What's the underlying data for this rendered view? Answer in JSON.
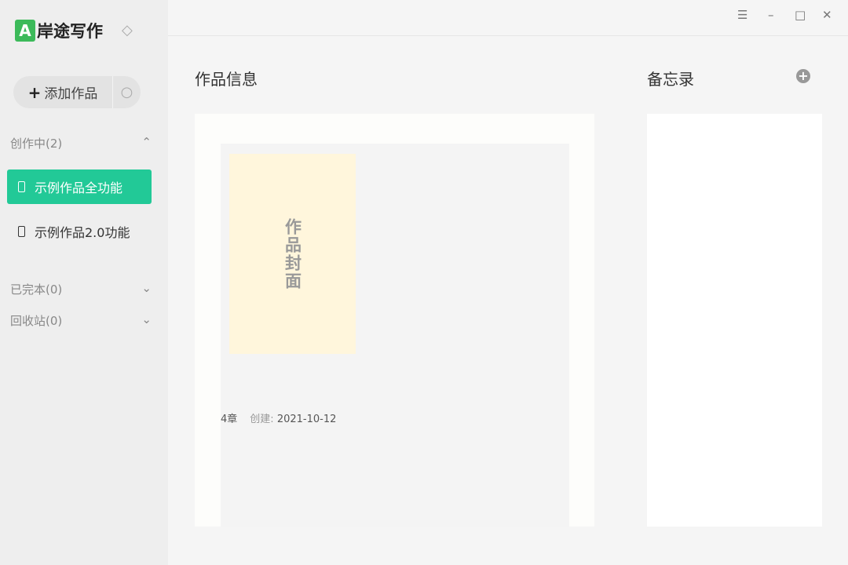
{
  "app": {
    "logo_letter": "A",
    "name": "岸途写作",
    "vip_icon": "diamond-icon"
  },
  "sidebar": {
    "add_label": "添加作品",
    "plus": "+",
    "sync_icon": "refresh-icon",
    "sections": [
      {
        "label": "创作中(2)",
        "chev": "⌃"
      },
      {
        "label": "已完本(0)",
        "chev": "⌄"
      },
      {
        "label": "回收站(0)",
        "chev": "⌄"
      }
    ],
    "items": [
      {
        "label": "示例作品全功能"
      },
      {
        "label": "示例作品2.0功能"
      }
    ]
  },
  "window": {
    "menu": "☰",
    "min": "–",
    "max": "□",
    "close": "✕"
  },
  "main": {
    "title": "作品信息",
    "cover_text": "作品封面",
    "chapters": "4章",
    "created_label": "创建:",
    "created_date": "2021-10-12"
  },
  "memo": {
    "title": "备忘录",
    "add": "+"
  }
}
